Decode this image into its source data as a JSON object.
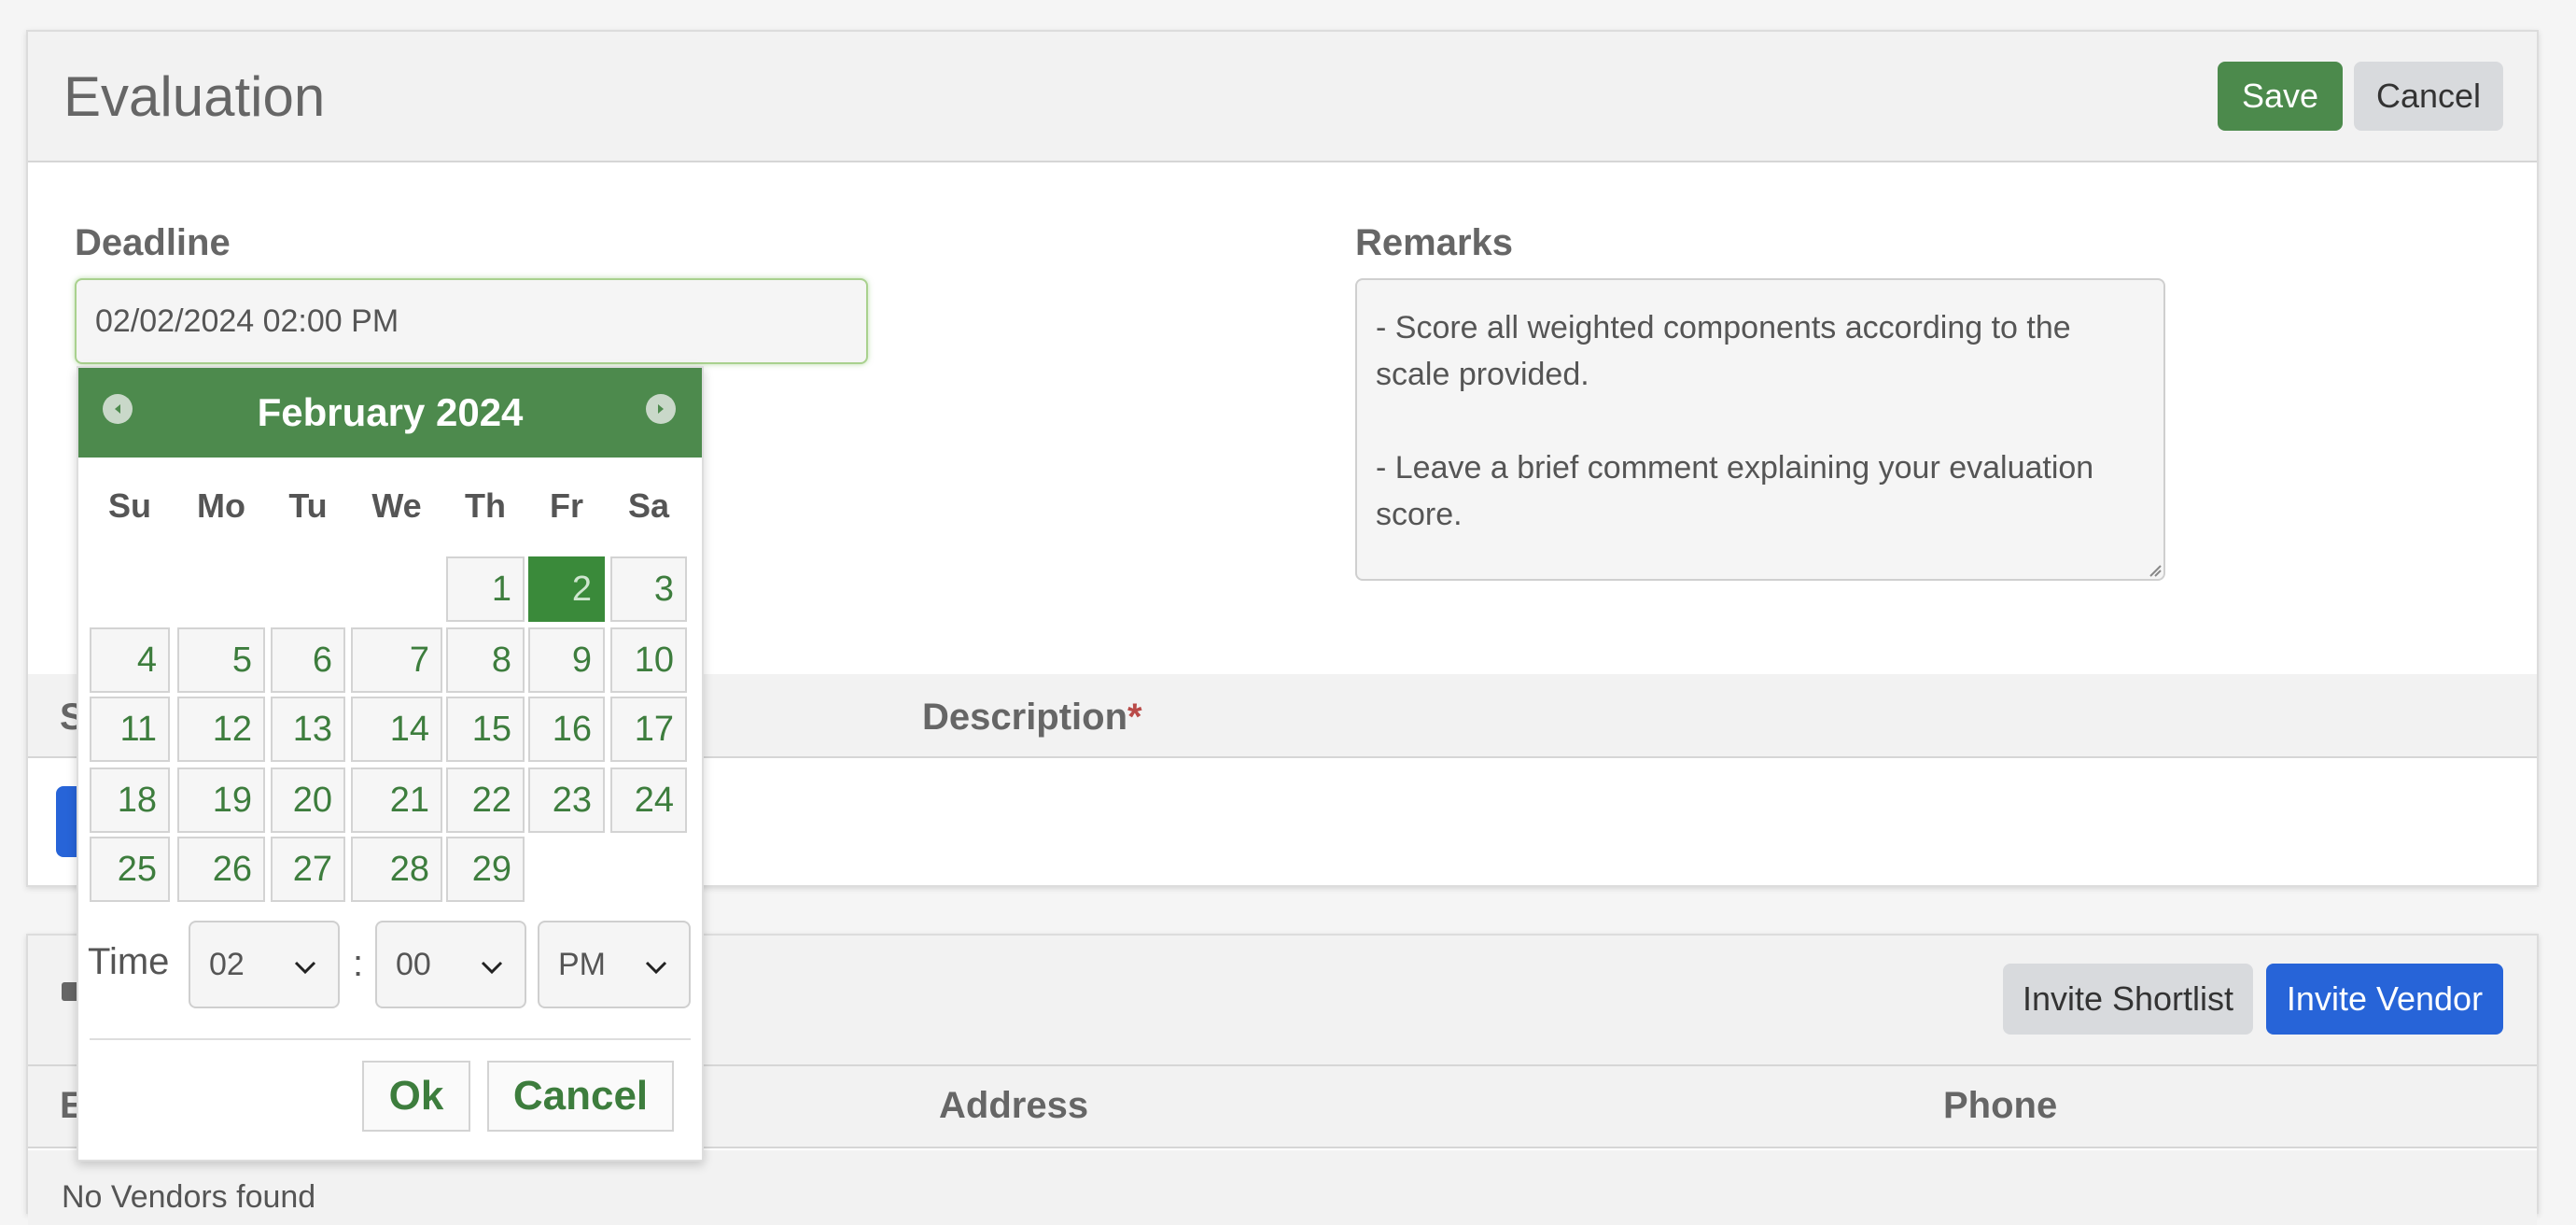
{
  "evaluation": {
    "title": "Evaluation",
    "save_label": "Save",
    "cancel_label": "Cancel",
    "deadline_label": "Deadline",
    "deadline_value": "02/02/2024 02:00 PM",
    "remarks_label": "Remarks",
    "remarks_value": "- Score all weighted components according to the scale provided.\n\n- Leave a brief comment explaining your evaluation score.",
    "table_headers": [
      "S",
      "Description"
    ],
    "required_mark": "*"
  },
  "vendors": {
    "invite_shortlist_label": "Invite Shortlist",
    "invite_vendor_label": "Invite Vendor",
    "table_headers": [
      "E",
      "Address",
      "Phone"
    ],
    "empty_text": "No Vendors found"
  },
  "datepicker": {
    "month_year": "February 2024",
    "weekdays": [
      "Su",
      "Mo",
      "Tu",
      "We",
      "Th",
      "Fr",
      "Sa"
    ],
    "days": [
      "1",
      "2",
      "3",
      "4",
      "5",
      "6",
      "7",
      "8",
      "9",
      "10",
      "11",
      "12",
      "13",
      "14",
      "15",
      "16",
      "17",
      "18",
      "19",
      "20",
      "21",
      "22",
      "23",
      "24",
      "25",
      "26",
      "27",
      "28",
      "29"
    ],
    "selected_day": "2",
    "time_label": "Time",
    "time_separator": ":",
    "hour": "02",
    "minute": "00",
    "ampm": "PM",
    "ok_label": "Ok",
    "cancel_label": "Cancel"
  },
  "colors": {
    "primary_green": "#4c8a4c",
    "accent_blue": "#2764d8",
    "required_red": "#b94a48"
  }
}
